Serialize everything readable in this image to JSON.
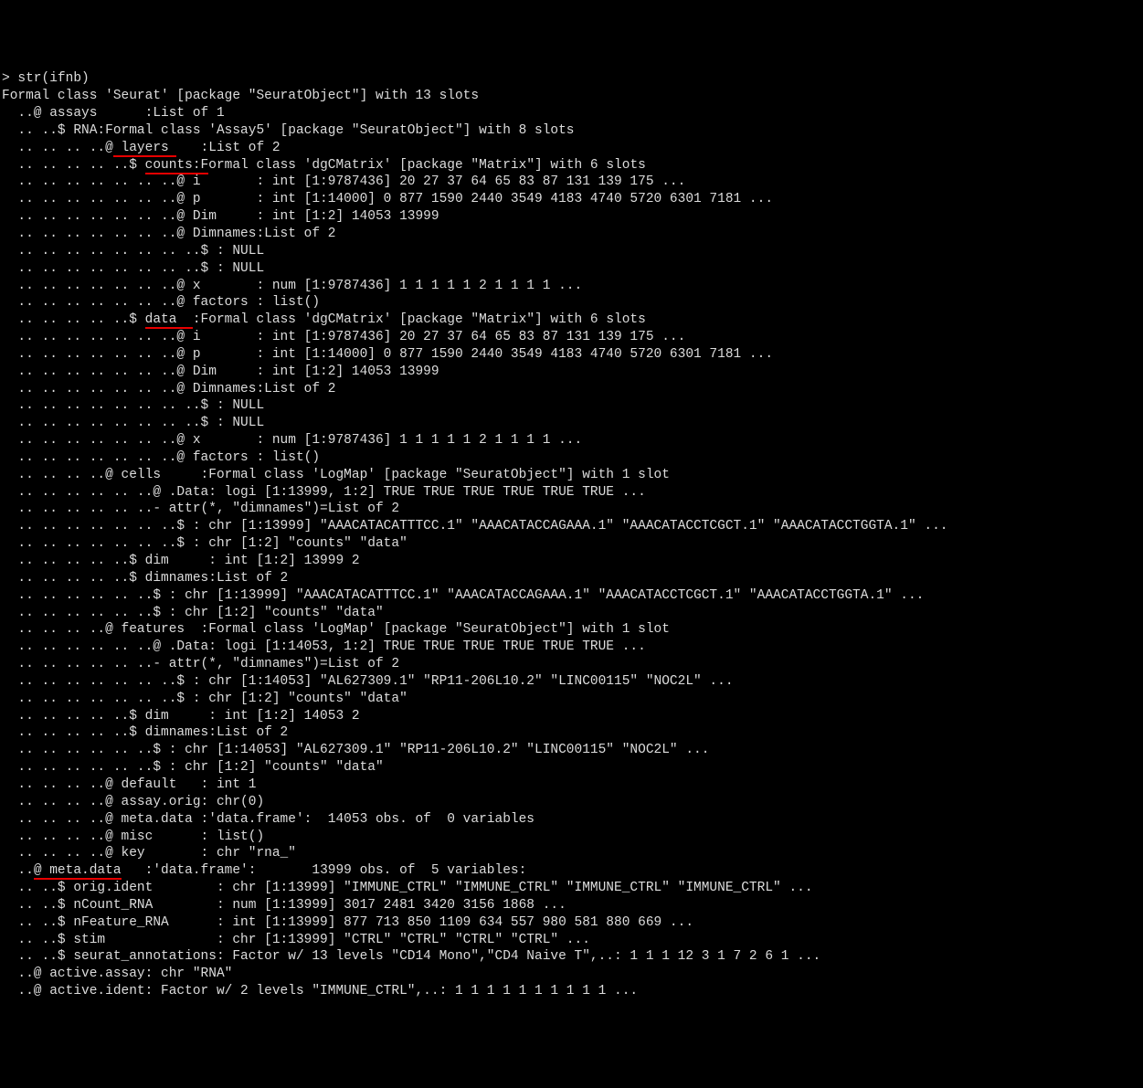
{
  "lines": [
    "> str(ifnb)",
    "Formal class 'Seurat' [package \"SeuratObject\"] with 13 slots",
    "  ..@ assays      :List of 1",
    "  .. ..$ RNA:Formal class 'Assay5' [package \"SeuratObject\"] with 8 slots",
    "  .. .. .. ..@ layers    :List of 2",
    "  .. .. .. .. ..$ counts:Formal class 'dgCMatrix' [package \"Matrix\"] with 6 slots",
    "  .. .. .. .. .. .. ..@ i       : int [1:9787436] 20 27 37 64 65 83 87 131 139 175 ...",
    "  .. .. .. .. .. .. ..@ p       : int [1:14000] 0 877 1590 2440 3549 4183 4740 5720 6301 7181 ...",
    "  .. .. .. .. .. .. ..@ Dim     : int [1:2] 14053 13999",
    "  .. .. .. .. .. .. ..@ Dimnames:List of 2",
    "  .. .. .. .. .. .. .. ..$ : NULL",
    "  .. .. .. .. .. .. .. ..$ : NULL",
    "  .. .. .. .. .. .. ..@ x       : num [1:9787436] 1 1 1 1 1 2 1 1 1 1 ...",
    "  .. .. .. .. .. .. ..@ factors : list()",
    "  .. .. .. .. ..$ data  :Formal class 'dgCMatrix' [package \"Matrix\"] with 6 slots",
    "  .. .. .. .. .. .. ..@ i       : int [1:9787436] 20 27 37 64 65 83 87 131 139 175 ...",
    "  .. .. .. .. .. .. ..@ p       : int [1:14000] 0 877 1590 2440 3549 4183 4740 5720 6301 7181 ...",
    "  .. .. .. .. .. .. ..@ Dim     : int [1:2] 14053 13999",
    "  .. .. .. .. .. .. ..@ Dimnames:List of 2",
    "  .. .. .. .. .. .. .. ..$ : NULL",
    "  .. .. .. .. .. .. .. ..$ : NULL",
    "  .. .. .. .. .. .. ..@ x       : num [1:9787436] 1 1 1 1 1 2 1 1 1 1 ...",
    "  .. .. .. .. .. .. ..@ factors : list()",
    "  .. .. .. ..@ cells     :Formal class 'LogMap' [package \"SeuratObject\"] with 1 slot",
    "  .. .. .. .. .. ..@ .Data: logi [1:13999, 1:2] TRUE TRUE TRUE TRUE TRUE TRUE ...",
    "  .. .. .. .. .. ..- attr(*, \"dimnames\")=List of 2",
    "  .. .. .. .. .. .. ..$ : chr [1:13999] \"AAACATACATTTCC.1\" \"AAACATACCAGAAA.1\" \"AAACATACCTCGCT.1\" \"AAACATACCTGGTA.1\" ...",
    "  .. .. .. .. .. .. ..$ : chr [1:2] \"counts\" \"data\"",
    "  .. .. .. .. ..$ dim     : int [1:2] 13999 2",
    "  .. .. .. .. ..$ dimnames:List of 2",
    "  .. .. .. .. .. ..$ : chr [1:13999] \"AAACATACATTTCC.1\" \"AAACATACCAGAAA.1\" \"AAACATACCTCGCT.1\" \"AAACATACCTGGTA.1\" ...",
    "  .. .. .. .. .. ..$ : chr [1:2] \"counts\" \"data\"",
    "  .. .. .. ..@ features  :Formal class 'LogMap' [package \"SeuratObject\"] with 1 slot",
    "  .. .. .. .. .. ..@ .Data: logi [1:14053, 1:2] TRUE TRUE TRUE TRUE TRUE TRUE ...",
    "  .. .. .. .. .. ..- attr(*, \"dimnames\")=List of 2",
    "  .. .. .. .. .. .. ..$ : chr [1:14053] \"AL627309.1\" \"RP11-206L10.2\" \"LINC00115\" \"NOC2L\" ...",
    "  .. .. .. .. .. .. ..$ : chr [1:2] \"counts\" \"data\"",
    "  .. .. .. .. ..$ dim     : int [1:2] 14053 2",
    "  .. .. .. .. ..$ dimnames:List of 2",
    "  .. .. .. .. .. ..$ : chr [1:14053] \"AL627309.1\" \"RP11-206L10.2\" \"LINC00115\" \"NOC2L\" ...",
    "  .. .. .. .. .. ..$ : chr [1:2] \"counts\" \"data\"",
    "  .. .. .. ..@ default   : int 1",
    "  .. .. .. ..@ assay.orig: chr(0)",
    "  .. .. .. ..@ meta.data :'data.frame':  14053 obs. of  0 variables",
    "  .. .. .. ..@ misc      : list()",
    "  .. .. .. ..@ key       : chr \"rna_\"",
    "  ..@ meta.data   :'data.frame':       13999 obs. of  5 variables:",
    "  .. ..$ orig.ident        : chr [1:13999] \"IMMUNE_CTRL\" \"IMMUNE_CTRL\" \"IMMUNE_CTRL\" \"IMMUNE_CTRL\" ...",
    "  .. ..$ nCount_RNA        : num [1:13999] 3017 2481 3420 3156 1868 ...",
    "  .. ..$ nFeature_RNA      : int [1:13999] 877 713 850 1109 634 557 980 581 880 669 ...",
    "  .. ..$ stim              : chr [1:13999] \"CTRL\" \"CTRL\" \"CTRL\" \"CTRL\" ...",
    "  .. ..$ seurat_annotations: Factor w/ 13 levels \"CD14 Mono\",\"CD4 Naive T\",..: 1 1 1 12 3 1 7 2 6 1 ...",
    "  ..@ active.assay: chr \"RNA\"",
    "  ..@ active.ident: Factor w/ 2 levels \"IMMUNE_CTRL\",..: 1 1 1 1 1 1 1 1 1 1 ..."
  ],
  "underlines": {
    "4": {
      "text": "@ layers",
      "start": 14,
      "end": 22
    },
    "5": {
      "text": "$ counts",
      "start": 18,
      "end": 26
    },
    "14": {
      "text": "$ data",
      "start": 18,
      "end": 24
    },
    "46": {
      "text": "@ meta.data",
      "start": 4,
      "end": 15
    }
  }
}
